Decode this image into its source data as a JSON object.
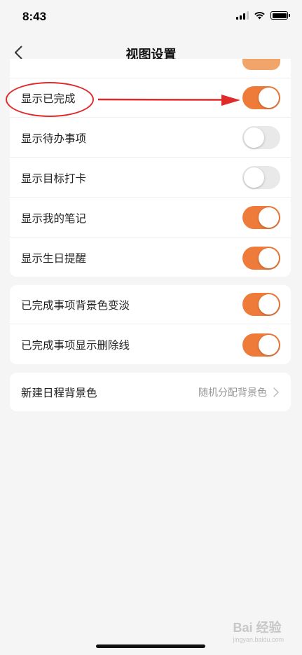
{
  "status_bar": {
    "time": "8:43"
  },
  "nav": {
    "title": "视图设置"
  },
  "settings_group_1": [
    {
      "label": "显示已完成",
      "on": true
    },
    {
      "label": "显示待办事项",
      "on": false
    },
    {
      "label": "显示目标打卡",
      "on": false
    },
    {
      "label": "显示我的笔记",
      "on": true
    },
    {
      "label": "显示生日提醒",
      "on": true
    }
  ],
  "settings_group_2": [
    {
      "label": "已完成事项背景色变淡",
      "on": true
    },
    {
      "label": "已完成事项显示删除线",
      "on": true
    }
  ],
  "schedule_bg": {
    "label": "新建日程背景色",
    "value": "随机分配背景色"
  },
  "watermark": {
    "brand": "Bai 经验",
    "url": "jingyan.baidu.com"
  },
  "colors": {
    "accent": "#ef7b3a",
    "annotation": "#e02a2a",
    "toggle_off": "#e9e9ea"
  }
}
